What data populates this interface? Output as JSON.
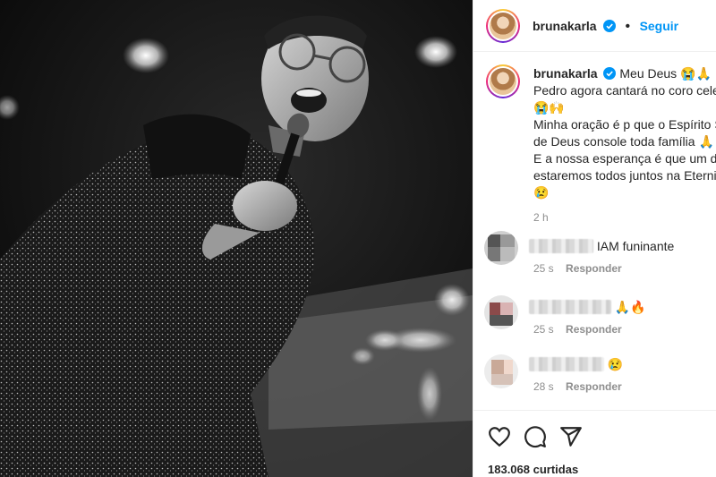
{
  "post": {
    "username": "brunakarla",
    "follow_label": "Seguir",
    "caption_lines": [
      "Meu Deus 😭🙏",
      "Pedro agora cantará no coro celestial",
      "😭🙌",
      "Minha oração é p que o Espírito Santo",
      "de Deus console toda família 🙏",
      "E a nossa esperança é que um dia",
      "estaremos todos juntos na Eternidade",
      "😢"
    ],
    "caption_time": "2 h",
    "likes": "183.068 curtidas"
  },
  "comments": [
    {
      "text": "IAM funinante",
      "time": "25 s",
      "reply": "Responder"
    },
    {
      "text": "🙏🔥",
      "time": "25 s",
      "reply": "Responder"
    },
    {
      "text": "😢",
      "time": "28 s",
      "reply": "Responder"
    }
  ],
  "icons": {
    "verified": "verified-badge-icon",
    "like": "heart-icon",
    "comment": "comment-bubble-icon",
    "share": "paper-plane-icon"
  },
  "colors": {
    "accent": "#0095f6",
    "muted": "#8e8e8e",
    "text": "#262626"
  }
}
